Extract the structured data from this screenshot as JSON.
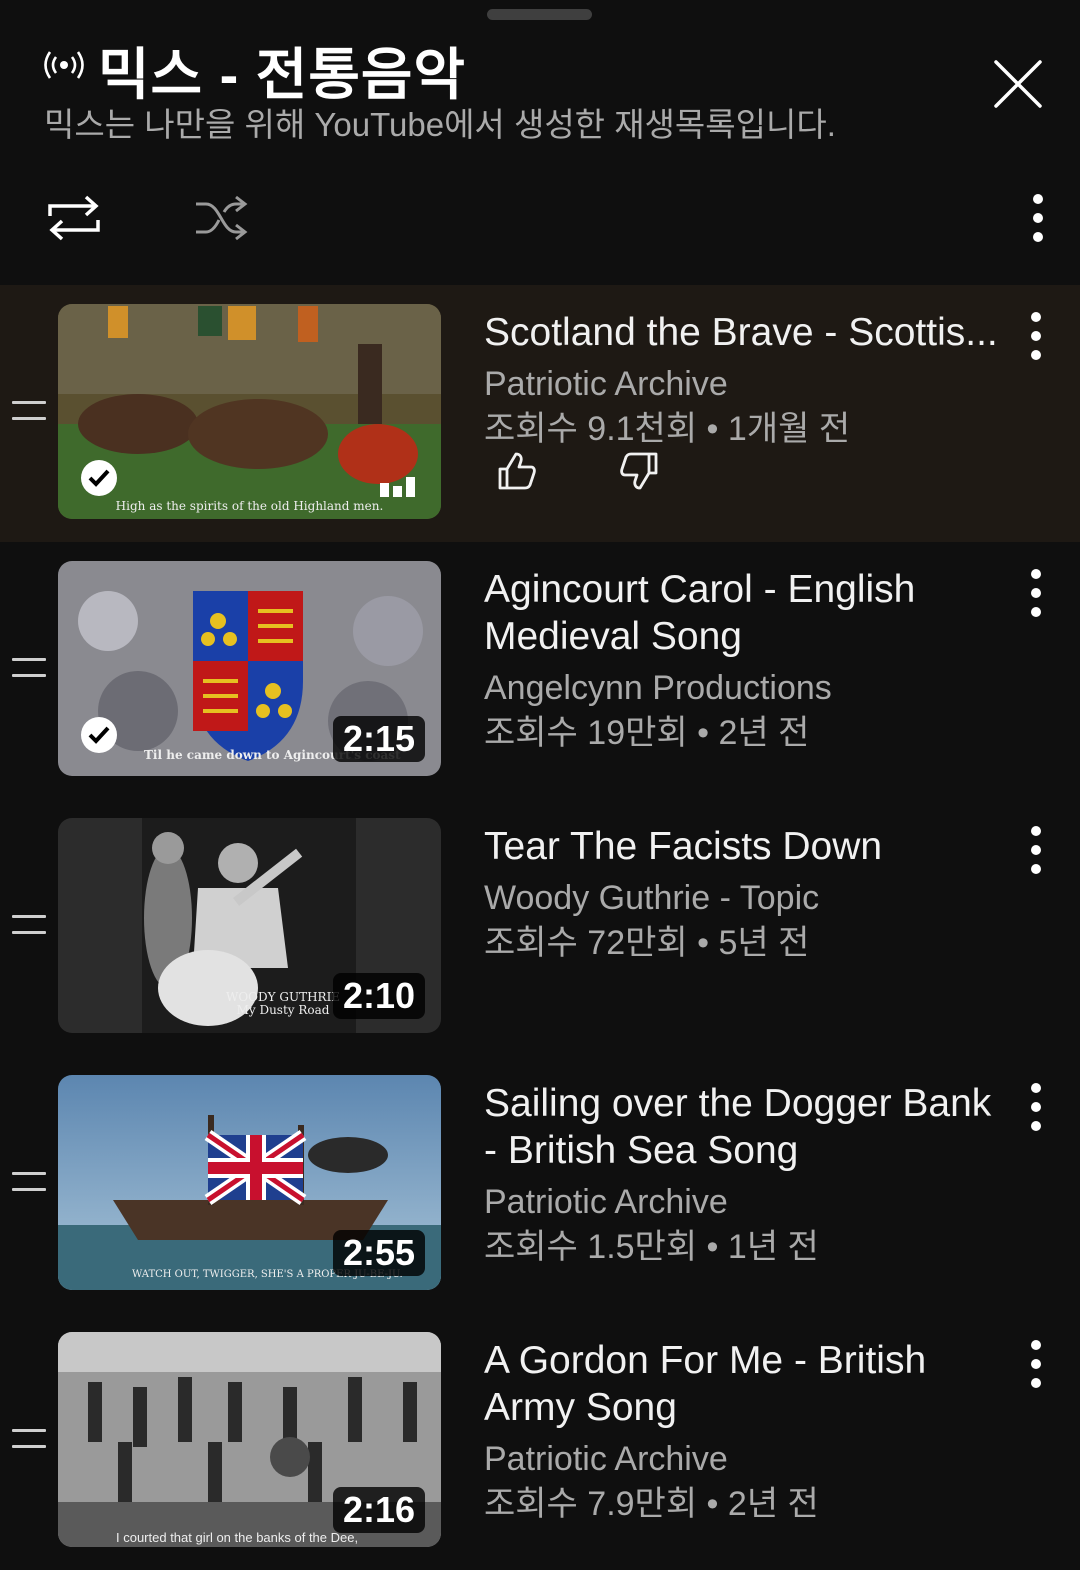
{
  "header": {
    "title": "믹스 - 전통음악",
    "subtitle": "믹스는 나만을 위해 YouTube에서 생성한 재생목록입니다.",
    "live_icon": "broadcast-icon"
  },
  "controls": {
    "loop_icon": "loop-icon",
    "shuffle_icon": "shuffle-icon",
    "more_icon": "more-vert-icon",
    "close_icon": "close-icon"
  },
  "videos": [
    {
      "title": "Scotland the Brave - Scottis...",
      "channel": "Patriotic Archive",
      "meta": "조회수 9.1천회 • 1개월 전",
      "caption": "High as the spirits of the old Highland men.",
      "duration": "",
      "watched": true,
      "now_playing": true
    },
    {
      "title": "Agincourt Carol - English Medieval Song",
      "channel": "Angelcynn Productions",
      "meta": "조회수 19만회 • 2년 전",
      "caption": "Til he came down to Agincourt's coast",
      "duration": "2:15",
      "watched": true
    },
    {
      "title": "Tear The Facists Down",
      "channel": "Woody Guthrie - Topic",
      "meta": "조회수 72만회 • 5년 전",
      "caption_line1": "WOODY GUTHRIE",
      "caption_line2": "My Dusty Road",
      "duration": "2:10"
    },
    {
      "title": "Sailing over the Dogger Bank - British Sea Song",
      "channel": "Patriotic Archive",
      "meta": "조회수 1.5만회 • 1년 전",
      "caption": "WATCH OUT, TWIGGER, SHE'S A PROPER JU-BE-JU.",
      "duration": "2:55"
    },
    {
      "title": "A Gordon For Me - British Army Song",
      "channel": "Patriotic Archive",
      "meta": "조회수 7.9만회 • 2년 전",
      "caption": "I courted that girl on the banks of the Dee,",
      "duration": "2:16"
    }
  ]
}
